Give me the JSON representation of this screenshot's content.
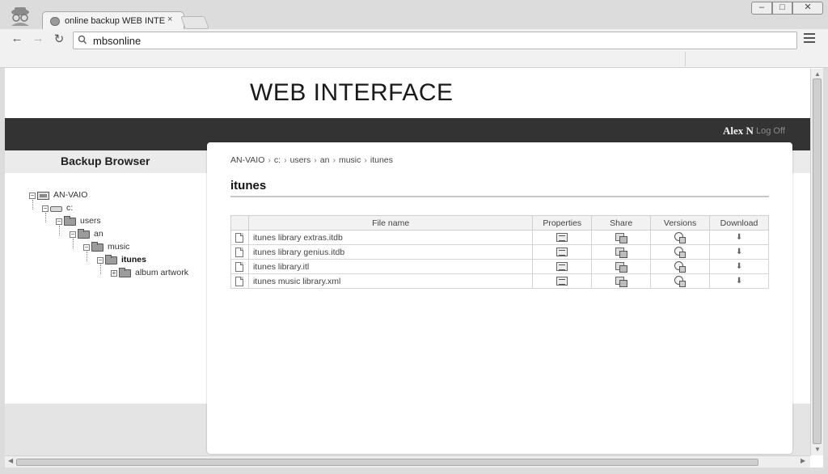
{
  "browser": {
    "tab_title": "online backup WEB INTERFACE",
    "tab_close": "×",
    "address": "mbsonline",
    "window_buttons": {
      "minimize": "–",
      "maximize": "□",
      "close": "✕"
    },
    "nav": {
      "back": "←",
      "forward": "→",
      "reload": "↻"
    }
  },
  "header": {
    "title": "WEB INTERFACE",
    "user_name": "Alex N",
    "logoff_label": "Log Off"
  },
  "sidebar": {
    "title": "Backup Browser",
    "tree": [
      {
        "label": "AN-VAIO",
        "toggle": "−",
        "icon": "computer-icon"
      },
      {
        "label": "c:",
        "toggle": "−",
        "icon": "drive-icon"
      },
      {
        "label": "users",
        "toggle": "−",
        "icon": "folder-icon"
      },
      {
        "label": "an",
        "toggle": "−",
        "icon": "folder-icon"
      },
      {
        "label": "music",
        "toggle": "−",
        "icon": "folder-icon"
      },
      {
        "label": "itunes",
        "toggle": "−",
        "icon": "folder-icon",
        "selected": true
      },
      {
        "label": "album artwork",
        "toggle": "+",
        "icon": "folder-icon"
      }
    ]
  },
  "main": {
    "breadcrumb": [
      "AN-VAIO",
      "c:",
      "users",
      "an",
      "music",
      "itunes"
    ],
    "breadcrumb_sep": "›",
    "heading": "itunes",
    "table": {
      "columns": [
        "File name",
        "Properties",
        "Share",
        "Versions",
        "Download"
      ],
      "rows": [
        {
          "name": "itunes library extras.itdb"
        },
        {
          "name": "itunes library genius.itdb"
        },
        {
          "name": "itunes library.itl"
        },
        {
          "name": "itunes music library.xml"
        }
      ]
    }
  },
  "scroll_arrows": {
    "up": "▲",
    "down": "▼",
    "left": "◀",
    "right": "▶"
  }
}
